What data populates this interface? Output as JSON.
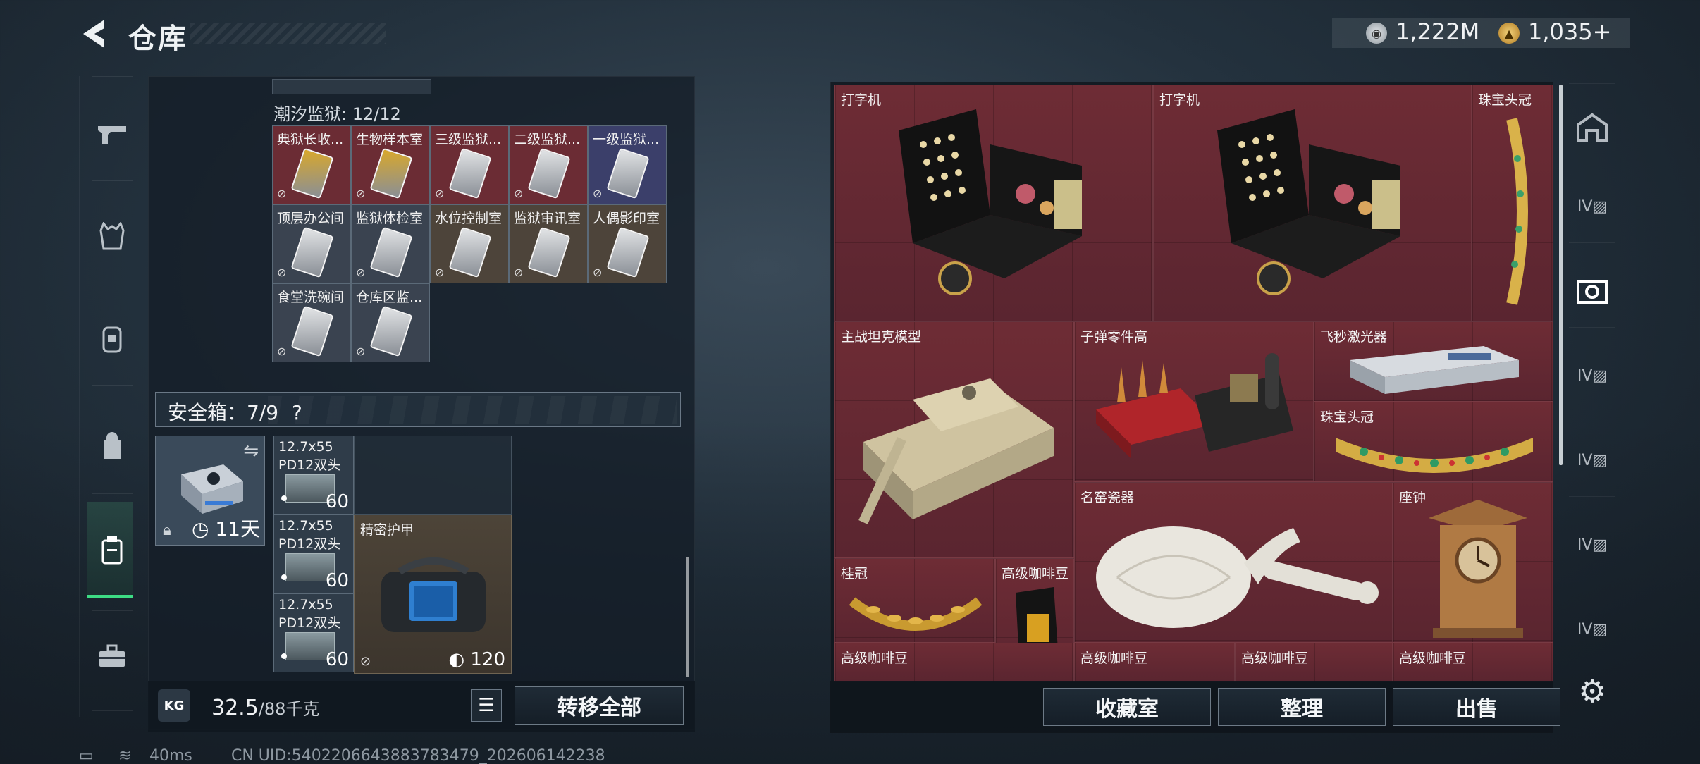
{
  "header": {
    "title": "仓库",
    "currency_silver": "1,222M",
    "currency_gold": "1,035+"
  },
  "left_nav": {
    "items": [
      "gun-icon",
      "vest-icon",
      "armor-icon",
      "backpack-icon",
      "safebox-icon",
      "toolbox-icon"
    ]
  },
  "prison": {
    "heading": "潮汐监狱: 12/12",
    "cards": [
      {
        "label": "典狱长收...",
        "color": "#d9a82b"
      },
      {
        "label": "生物样本室",
        "color": "#d9a82b"
      },
      {
        "label": "三级监狱...",
        "color": "#e2e4e6"
      },
      {
        "label": "二级监狱...",
        "color": "#e2e4e6"
      },
      {
        "label": "一级监狱...",
        "color": "#e2e4e6"
      },
      {
        "label": "顶层办公间",
        "color": "#e2e4e6"
      },
      {
        "label": "监狱体检室",
        "color": "#e2e4e6"
      },
      {
        "label": "水位控制室",
        "color": "#e2e4e6"
      },
      {
        "label": "监狱审讯室",
        "color": "#e2e4e6"
      },
      {
        "label": "人偶影印室",
        "color": "#e2e4e6"
      },
      {
        "label": "食堂洗碗间",
        "color": "#e2e4e6"
      },
      {
        "label": "仓库区监...",
        "color": "#e2e4e6"
      }
    ]
  },
  "safebox": {
    "label": "安全箱：7/9",
    "help": "?",
    "days": "11天",
    "ammo": [
      {
        "line1": "12.7x55",
        "line2": "PD12双头",
        "count": "60"
      },
      {
        "line1": "12.7x55",
        "line2": "PD12双头",
        "count": "60"
      },
      {
        "line1": "12.7x55",
        "line2": "PD12双头",
        "count": "60"
      }
    ],
    "armor_label": "精密护甲",
    "armor_durability": "120"
  },
  "footer_left": {
    "kg_icon": "KG",
    "weight": "32.5",
    "weight_max": "/88千克",
    "transfer_all": "转移全部"
  },
  "grid_items": {
    "typewriter_1": "打字机",
    "typewriter_2": "打字机",
    "crown_1": "珠宝头冠",
    "tank": "主战坦克模型",
    "bullet_parts": "子弹零件高",
    "laser": "飞秒激光器",
    "crown_2": "珠宝头冠",
    "porcelain": "名窑瓷器",
    "clock": "座钟",
    "laurel": "桂冠",
    "coffee_1": "高级咖啡豆",
    "coffee_2": "高级咖啡豆",
    "coffee_3": "高级咖啡豆",
    "coffee_4": "高级咖啡豆",
    "coffee_5": "高级咖啡豆"
  },
  "footer_right": {
    "collection": "收藏室",
    "sort": "整理",
    "sell": "出售"
  },
  "status_bar": {
    "ping": "40ms",
    "uid": "CN UID:5402206643883783479_202606142238"
  },
  "colors": {
    "accent_green": "#3ddc84",
    "item_red": "#6e2c35",
    "card_gold": "#d9a82b"
  }
}
